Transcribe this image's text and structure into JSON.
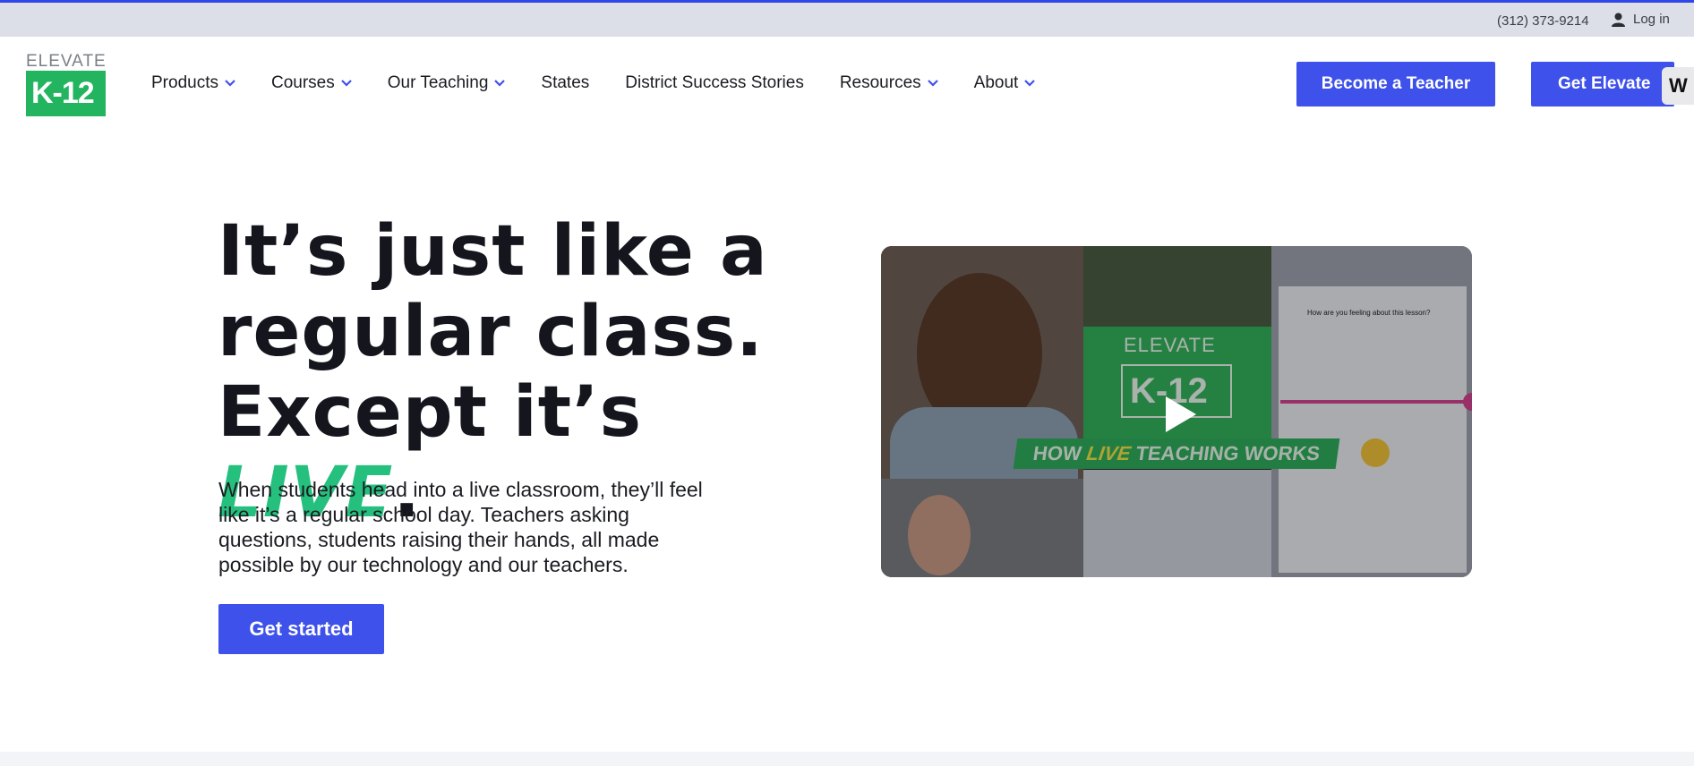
{
  "topbar": {
    "phone": "(312) 373-9214",
    "login": "Log in"
  },
  "logo": {
    "word": "ELEVATE",
    "mark": "K-12"
  },
  "nav": {
    "items": [
      {
        "label": "Products",
        "dropdown": true
      },
      {
        "label": "Courses",
        "dropdown": true
      },
      {
        "label": "Our Teaching",
        "dropdown": true
      },
      {
        "label": "States",
        "dropdown": false
      },
      {
        "label": "District Success Stories",
        "dropdown": false
      },
      {
        "label": "Resources",
        "dropdown": true
      },
      {
        "label": "About",
        "dropdown": true
      }
    ]
  },
  "cta": {
    "teacher": "Become a Teacher",
    "elevate": "Get Elevate",
    "side_tab": "W"
  },
  "hero": {
    "line1": "It’s just like a",
    "line2": "regular class.",
    "line3_pre": "Except it’s ",
    "line3_live": "LIVE",
    "line3_post": ".",
    "body": "When students head into a live classroom, they’ll feel like it’s a regular school day. Teachers asking questions, students raising their hands, all made possible by our technology and our teachers.",
    "button": "Get started"
  },
  "video": {
    "logo_word": "ELEVATE",
    "logo_mark": "K-12",
    "banner_pre": "HOW",
    "banner_live": "LIVE",
    "banner_post": "TEACHING WORKS",
    "question": "How are you feeling about this lesson?"
  },
  "colors": {
    "accent": "#3e51ea",
    "brand_green": "#22b45e",
    "live_green": "#26c07e",
    "topbar": "#dcdfe8"
  }
}
